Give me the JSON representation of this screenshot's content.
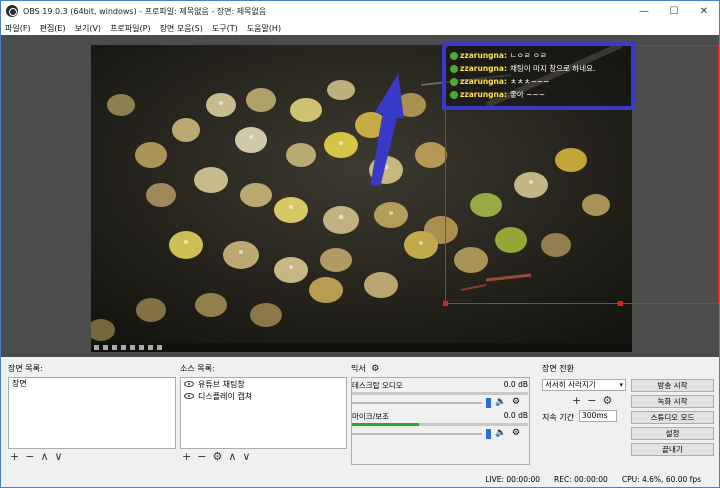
{
  "window": {
    "title": "OBS 19.0.3 (64bit, windows) - 프로파일: 제목없음 - 장면: 제목없음"
  },
  "menu": [
    "파일(F)",
    "편집(E)",
    "보기(V)",
    "프로파일(P)",
    "장면 모음(S)",
    "도구(T)",
    "도움말(H)"
  ],
  "chat": [
    {
      "user": "zzarungna:",
      "msg": "ㄴㅇㄹ ㅇㄹ"
    },
    {
      "user": "zzarungna:",
      "msg": "채팅이 마지 창으로 하네요."
    },
    {
      "user": "zzarungna:",
      "msg": "ㅊㅊㅊ~~~"
    },
    {
      "user": "zzarungna:",
      "msg": "좋아 ~~~"
    }
  ],
  "scenes": {
    "label": "장면 목록:",
    "items": [
      "장면"
    ]
  },
  "sources": {
    "label": "소스 목록:",
    "items": [
      "유튜브 채팅창",
      "디스플레이 캡쳐"
    ]
  },
  "mixer": {
    "label": "믹서",
    "channels": [
      {
        "name": "데스크탑 오디오",
        "db": "0.0 dB",
        "level": 0.0
      },
      {
        "name": "마이크/보조",
        "db": "0.0 dB",
        "level": 0.38
      }
    ]
  },
  "transition": {
    "label": "장면 전환",
    "selected": "서서히 사라지기",
    "duration_label": "지속 기간",
    "duration": "300ms"
  },
  "controls": [
    "방송 시작",
    "녹화 시작",
    "스튜디오 모드",
    "설정",
    "끝내기"
  ],
  "status": {
    "live": "LIVE: 00:00:00",
    "rec": "REC: 00:00:00",
    "cpu": "CPU: 4.6%, 60.00 fps"
  },
  "colors": {
    "accent": "#3a3ac8",
    "selection": "#e02020",
    "meter": "#2aa82a"
  }
}
